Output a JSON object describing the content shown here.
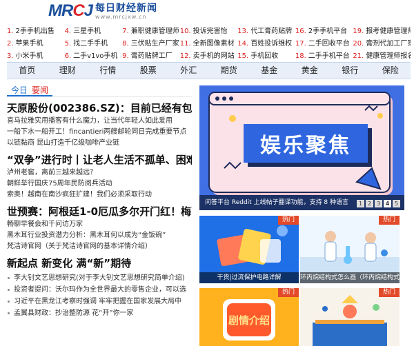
{
  "logo": {
    "mark_a": "MR",
    "mark_b": "C",
    "mark_c": "J",
    "cn": "每日财经新闻",
    "url": "www.mrcjxw.cn"
  },
  "top_links": [
    {
      "n": "1.",
      "t": "2手手机出售"
    },
    {
      "n": "4.",
      "t": "三星手机"
    },
    {
      "n": "7.",
      "t": "兼职健康管理师"
    },
    {
      "n": "10.",
      "t": "投诉完害怡"
    },
    {
      "n": "13.",
      "t": "代工膏药贴牌"
    },
    {
      "n": "16.",
      "t": "2手手机平台"
    },
    {
      "n": "19.",
      "t": "报考健康管理师"
    },
    {
      "n": "2.",
      "t": "苹果手机"
    },
    {
      "n": "5.",
      "t": "找二手手机"
    },
    {
      "n": "8.",
      "t": "三伏贴生产厂家"
    },
    {
      "n": "11.",
      "t": "全新图像素材"
    },
    {
      "n": "14.",
      "t": "百姓投诉维权"
    },
    {
      "n": "17.",
      "t": "二手回收平台"
    },
    {
      "n": "20.",
      "t": "膏剂代加工厂家"
    },
    {
      "n": "3.",
      "t": "小米手机"
    },
    {
      "n": "6.",
      "t": "二手v1vo手机"
    },
    {
      "n": "9.",
      "t": "膏药贴牌工厂"
    },
    {
      "n": "12.",
      "t": "卖手机的网站"
    },
    {
      "n": "15.",
      "t": "手机回收"
    },
    {
      "n": "18.",
      "t": "二手手机平台"
    },
    {
      "n": "21.",
      "t": "健康管理师报名"
    }
  ],
  "nav": [
    "首页",
    "理财",
    "行情",
    "股票",
    "外汇",
    "期货",
    "基金",
    "黄金",
    "银行",
    "保险"
  ],
  "section": {
    "a": "今日",
    "b": "要闻"
  },
  "news": [
    {
      "title": "天原股份(002386.SZ)：目前已经有包括头",
      "subs": [
        "喜马拉雅实用播客有什么魔力，让当代年轻人如此爱用",
        "一船下水一船开工！fincantieri两艘邮轮同日完成重要节点",
        "以链黏商 昆山打造千亿级咖啡产业链"
      ]
    },
    {
      "title": "“双争”进行时丨让老人生活不孤单、困难",
      "subs": [
        "泸州老窖，离前三越来越远？",
        "朝鲜举行国庆75周年民防阅兵活动",
        "索奥！越南在南沙疯狂扩建！我们必须采取行动"
      ]
    },
    {
      "title": "世预赛：阿根廷1-0厄瓜多尔开门红！梅西",
      "subs": [
        "畅聊早餐会和千问访万家",
        "黑木耳行业投资潜力分析：黑木耳何以成为“金饭碗”",
        "梵洁诗官网（关于梵洁诗官网的基本详情介绍）"
      ]
    },
    {
      "title": "新起点 新变化 满“新”期待",
      "subs": []
    }
  ],
  "list": [
    "李大钊文艺思想研究(对于李大钊文艺思想研究简单介绍)",
    "投资者提问：沃尔玛作为全世界最大的零售企业，可以选",
    "习近平在黑龙江考察时强调 牢牢把握在国家发展大局中",
    "孟翼县财政：抄治整防源 花“开”你一家"
  ],
  "banner": {
    "big_text": "娱乐聚焦",
    "caption": "问答平台 Reddit 上线帖子翻译功能，支持 8 种语言",
    "dots": [
      "1",
      "2",
      "3",
      "4",
      "5"
    ],
    "active": 3
  },
  "cards": [
    {
      "tag": "热门",
      "title": "干货|过流保护电路详解"
    },
    {
      "tag": "热门",
      "title": "环丙烷结构式怎么画（环丙烷结构式）"
    },
    {
      "tag": "热门",
      "title": "剧情介绍"
    },
    {
      "tag": "热门",
      "title": ""
    }
  ]
}
